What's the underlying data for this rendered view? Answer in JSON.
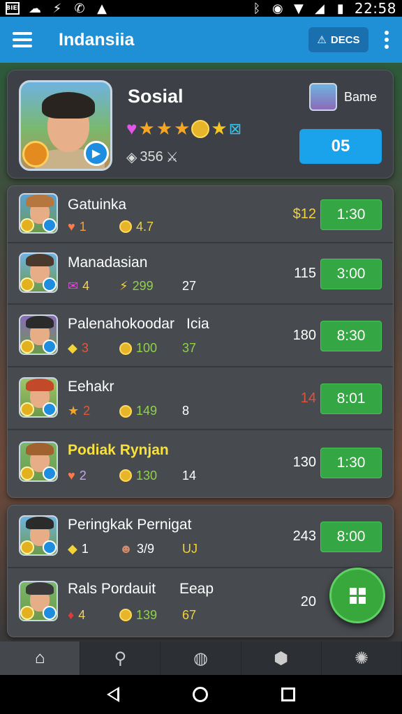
{
  "status_bar": {
    "left_icons": [
      "sim-icon",
      "cloud-icon",
      "messenger-icon",
      "whatsapp-icon",
      "drive-icon"
    ],
    "sim_label": "BIEl",
    "time": "22:58"
  },
  "app_bar": {
    "title": "Indansiia",
    "decs_label": "DECS"
  },
  "profile": {
    "name": "Sosial",
    "gem_value": "356",
    "side_label": "Bame",
    "score": "05"
  },
  "rows": [
    {
      "name": "Gatuinka",
      "extra": "",
      "stat1_icon": "heart-icon",
      "stat1_value": "1",
      "stat1_color": "#f0a040",
      "stat2_icon": "coin-icon",
      "stat2_value": "4.7",
      "stat2_color": "#e6d04a",
      "stat3": "",
      "number": "$12",
      "number_color": "#f2d33a",
      "time": "1:30"
    },
    {
      "name": "Manadasian",
      "extra": "",
      "stat1_icon": "envelope-icon",
      "stat1_value": "4",
      "stat1_color": "#f0d060",
      "stat2_icon": "lightning-icon",
      "stat2_value": "299",
      "stat2_color": "#8fd24a",
      "stat3": "27",
      "number": "115",
      "number_color": "#ffffff",
      "time": "3:00"
    },
    {
      "name": "Palenahokoodar",
      "extra": "Icia",
      "stat1_icon": "diamond-icon",
      "stat1_value": "3",
      "stat1_color": "#e05a3a",
      "stat2_icon": "coin-icon",
      "stat2_value": "100",
      "stat2_color": "#8fd24a",
      "stat3": "37",
      "number": "180",
      "number_color": "#ffffff",
      "time": "8:30"
    },
    {
      "name": "Eehakr",
      "extra": "",
      "stat1_icon": "star-icon",
      "stat1_value": "2",
      "stat1_color": "#e05a3a",
      "stat2_icon": "coin-icon",
      "stat2_value": "149",
      "stat2_color": "#8fd24a",
      "stat3": "8",
      "number": "14",
      "number_color": "#e0523a",
      "time": "8:01"
    },
    {
      "name": "Podiak Rynjan",
      "extra": "",
      "stat1_icon": "heart-icon",
      "stat1_value": "2",
      "stat1_color": "#c7a6f0",
      "stat2_icon": "coin-icon",
      "stat2_value": "130",
      "stat2_color": "#8fd24a",
      "stat3": "14",
      "number": "130",
      "number_color": "#ffffff",
      "time": "1:30"
    }
  ],
  "rows2": [
    {
      "name": "Peringkak Pernigat",
      "extra": "",
      "stat1_icon": "diamond-icon",
      "stat1_value": "1",
      "stat1_color": "#ffffff",
      "stat2_icon": "creature-icon",
      "stat2_value": "3/9",
      "stat2_color": "#ffffff",
      "stat3": "UJ",
      "number": "243",
      "number_color": "#ffffff",
      "time": "8:00"
    },
    {
      "name": "Rals Pordauit",
      "extra": "Eeap",
      "stat1_icon": "candy-icon",
      "stat1_value": "4",
      "stat1_color": "#f0d060",
      "stat2_icon": "coin-icon",
      "stat2_value": "139",
      "stat2_color": "#8fd24a",
      "stat3": "67",
      "number": "20",
      "number_color": "#ffffff",
      "time": ""
    }
  ],
  "tabs": [
    "home-icon",
    "search-icon",
    "ball-icon",
    "box-icon",
    "gear-icon"
  ]
}
